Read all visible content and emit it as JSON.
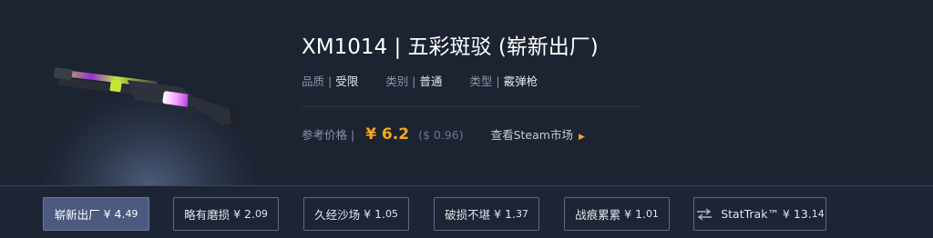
{
  "item": {
    "title": "XM1014 | 五彩斑驳 (崭新出厂)",
    "properties": [
      {
        "key": "品质 |",
        "value": "受限"
      },
      {
        "key": "类别 |",
        "value": "普通"
      },
      {
        "key": "类型 |",
        "value": "霰弹枪"
      }
    ],
    "price": {
      "label": "参考价格 |",
      "cny": "¥ 6.2",
      "usd": "($ 0.96)",
      "market_link": "查看Steam市场"
    }
  },
  "wear_options": [
    {
      "name": "崭新出厂",
      "price_int": "¥ 4.",
      "price_dec": "49"
    },
    {
      "name": "略有磨损",
      "price_int": "¥ 2.",
      "price_dec": "09"
    },
    {
      "name": "久经沙场",
      "price_int": "¥ 1.",
      "price_dec": "05"
    },
    {
      "name": "破损不堪",
      "price_int": "¥ 1.",
      "price_dec": "37"
    },
    {
      "name": "战痕累累",
      "price_int": "¥ 1.",
      "price_dec": "01"
    },
    {
      "name": "StatTrak™",
      "price_int": "¥ 13.",
      "price_dec": "14"
    }
  ],
  "colors": {
    "background": "#1b2230",
    "price_accent": "#f5a623",
    "active_button": "#4b5a7e",
    "button_border": "#5b6a8a"
  },
  "icons": [
    "shotgun-image",
    "chevron-right-icon",
    "swap-arrows-icon"
  ]
}
